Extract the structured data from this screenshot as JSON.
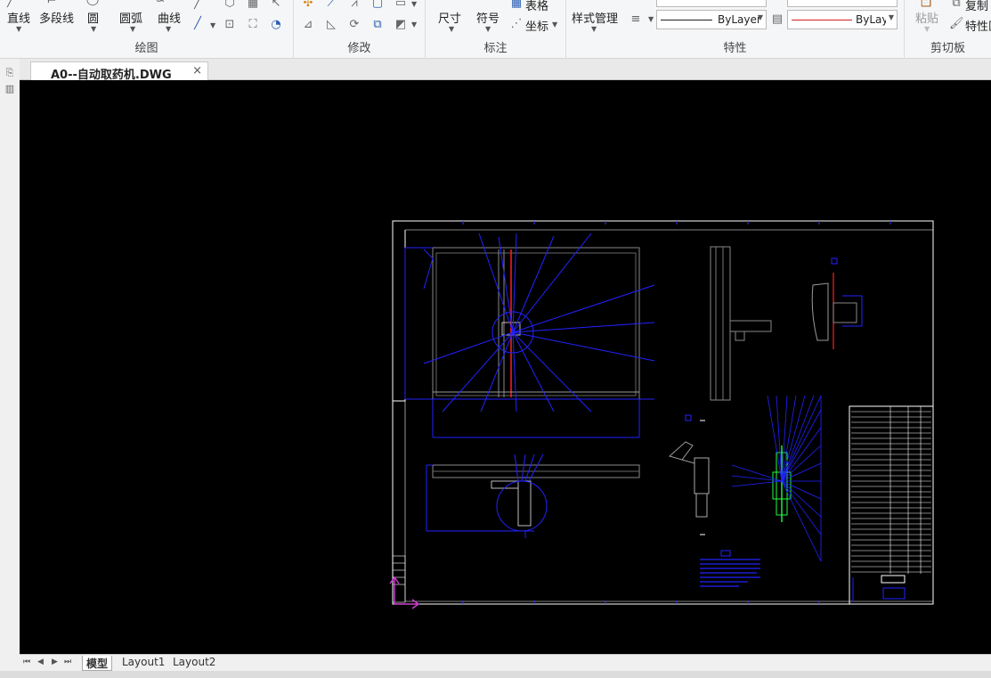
{
  "document": {
    "tab_title": "A0--自动取药机.DWG",
    "close_symbol": "×"
  },
  "ribbon": {
    "draw": {
      "title": "绘图",
      "line": "直线",
      "polyline": "多段线",
      "circle": "圆",
      "arc": "圆弧",
      "curve": "曲线"
    },
    "modify": {
      "title": "修改"
    },
    "annotate": {
      "title": "标注",
      "dimension": "尺寸",
      "symbol": "符号",
      "table": "表格",
      "coordinate": "坐标"
    },
    "properties": {
      "title": "特性",
      "style_manager": "样式管理",
      "linetype_value": "ByLayer",
      "color_value": "ByLay­"
    },
    "clipboard": {
      "title": "剪切板",
      "paste": "粘贴",
      "copy": "复制",
      "match_properties": "特性匹"
    }
  },
  "layouts": {
    "tabs": [
      "模型",
      "Layout1",
      "Layout2"
    ],
    "active": "模型"
  },
  "colors": {
    "canvas": "#000000",
    "frame": "#ffffff",
    "dim": "#2222ff",
    "accent_red": "#ff2020",
    "magenta": "#d040d0",
    "green": "#20ff40"
  }
}
